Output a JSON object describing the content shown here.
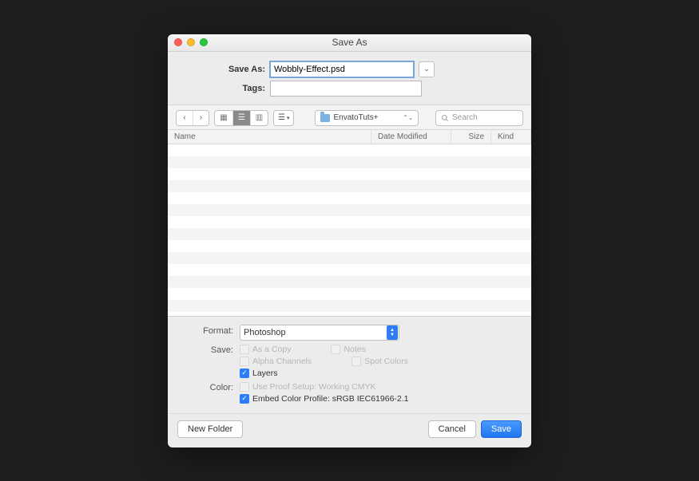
{
  "window": {
    "title": "Save As"
  },
  "form": {
    "saveas_label": "Save As:",
    "saveas_value": "Wobbly-Effect.psd",
    "tags_label": "Tags:",
    "tags_value": ""
  },
  "toolbar": {
    "folder_name": "EnvatoTuts+",
    "search_placeholder": "Search"
  },
  "columns": {
    "name": "Name",
    "date": "Date Modified",
    "size": "Size",
    "kind": "Kind"
  },
  "options": {
    "format_label": "Format:",
    "format_value": "Photoshop",
    "save_label": "Save:",
    "as_a_copy": "As a Copy",
    "notes": "Notes",
    "alpha_channels": "Alpha Channels",
    "spot_colors": "Spot Colors",
    "layers": "Layers",
    "color_label": "Color:",
    "use_proof": "Use Proof Setup:  Working CMYK",
    "embed_profile": "Embed Color Profile:  sRGB IEC61966-2.1"
  },
  "footer": {
    "new_folder": "New Folder",
    "cancel": "Cancel",
    "save": "Save"
  }
}
